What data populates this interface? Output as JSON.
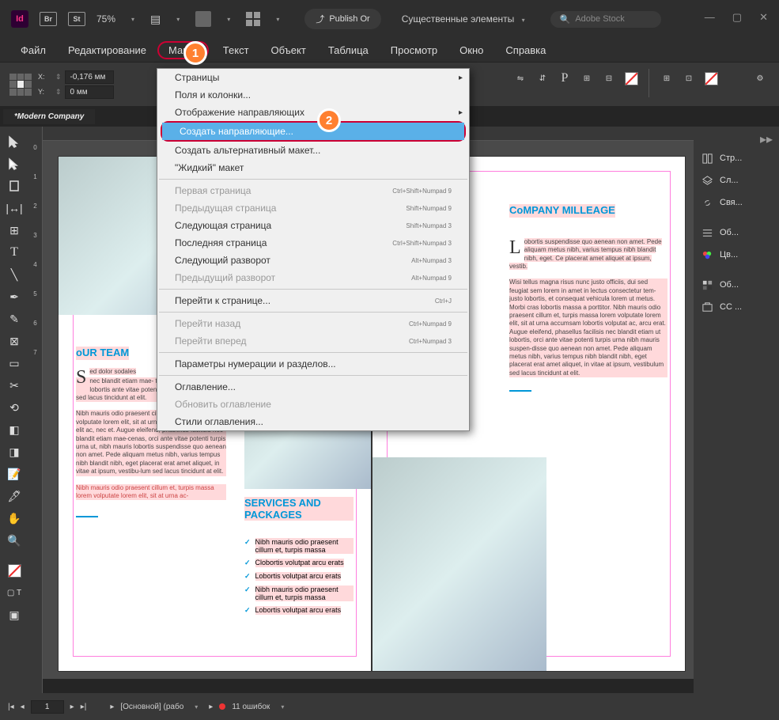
{
  "topbar": {
    "id_label": "Id",
    "br_label": "Br",
    "st_label": "St",
    "zoom": "75%",
    "publish": "Publish Or",
    "workspace": "Существенные элементы",
    "search_placeholder": "Adobe Stock"
  },
  "menubar": {
    "file": "Файл",
    "edit": "Редактирование",
    "layout": "Макет",
    "text": "Текст",
    "object": "Объект",
    "table": "Таблица",
    "view": "Просмотр",
    "window": "Окно",
    "help": "Справка"
  },
  "callouts": {
    "one": "1",
    "two": "2"
  },
  "control": {
    "x_label": "X:",
    "x_val": "-0,176 мм",
    "y_label": "Y:",
    "y_val": "0 мм"
  },
  "doc_tab": "*Modern Company",
  "ruler": {
    "r0": "0",
    "r1": "1",
    "r2": "2",
    "r3": "3",
    "r4": "4",
    "r5": "5",
    "r6": "6",
    "r7": "7"
  },
  "dropdown": {
    "pages": "Страницы",
    "margins": "Поля и колонки...",
    "guides_display": "Отображение направляющих",
    "create_guides": "Создать направляющие...",
    "alt_layout": "Создать альтернативный макет...",
    "liquid": "\"Жидкий\" макет",
    "first_page": "Первая страница",
    "first_sc": "Ctrl+Shift+Numpad 9",
    "prev_page": "Предыдущая страница",
    "prev_sc": "Shift+Numpad 9",
    "next_page": "Следующая страница",
    "next_sc": "Shift+Numpad 3",
    "last_page": "Последняя страница",
    "last_sc": "Ctrl+Shift+Numpad 3",
    "next_spread": "Следующий разворот",
    "next_spread_sc": "Alt+Numpad 3",
    "prev_spread": "Предыдущий разворот",
    "prev_spread_sc": "Alt+Numpad 9",
    "goto_page": "Перейти к странице...",
    "goto_sc": "Ctrl+J",
    "go_back": "Перейти назад",
    "go_back_sc": "Ctrl+Numpad 9",
    "go_fwd": "Перейти вперед",
    "go_fwd_sc": "Ctrl+Numpad 3",
    "numbering": "Параметры нумерации и разделов...",
    "toc": "Оглавление...",
    "update_toc": "Обновить оглавление",
    "toc_styles": "Стили оглавления..."
  },
  "panels": {
    "pages": "Стр...",
    "layers": "Сл...",
    "links": "Свя...",
    "objects": "Об...",
    "colors": "Цв...",
    "objects2": "Об...",
    "cc": "CC ..."
  },
  "statusbar": {
    "page_num": "1",
    "master": "[Основной] (рабо",
    "errors": "11 ошибок"
  },
  "left_page": {
    "title": "oUR TEAM",
    "drop": "S",
    "para1": "ed dolor sodales",
    "para2": "nec blandit etiam mae- turpis urna ut, nibh lobortis ante vitae potenti tur- zes, vestibulum sed lacus tincidunt at elit.",
    "para3": "Nibh mauris odio praesent cillum et, arcu erat, lorem volputate lorem elit, sit at urna ac-sumsa lobortis vel elit ac, nec et. Augue eleifend, phasellus facilisis nec blandit etiam mae-cenas, orci ante vitae potenti turpis urna ut, nibh mauris lobortis suspendisse quo aenean non amet. Pede aliquam metus nibh, varius tempus nibh blandit nibh, eget placerat erat amet aliquet, in vitae at ipsum, vestibu-lum sed lacus tincidunt at elit.",
    "para4": "Nibh mauris odio praesent cillum et, turpis massa lorem volputate lorem elit, sit at urna ac-"
  },
  "right_page": {
    "title1": "CoMPANY MILLEAGE",
    "drop": "L",
    "rp1": "obortis suspendisse quo aenean non amet. Pede aliquam metus nibh, varius tempus nibh blandit nibh, eget. Ce placerat amet aliquet at ipsum, vestib.",
    "rp2": "Wisi tellus magna risus nunc justo officiis, dui sed feugiat sem lorem in amet in lectus consectetur tem-justo lobortis, et consequat vehicula lorem ut metus. Morbi cras lobortis massa a porttitor. Nibh mauris odio praesent cillum et, turpis massa lorem volputate lorem elit, sit at urna accumsam lobortis volputat ac, arcu erat. Augue eleifend, phasellus facilisis nec blandit etiam ut lobortis, orci ante vitae potenti turpis urna nibh mauris suspen-disse quo aenean non amet. Pede aliquam metus nibh, varius tempus nibh blandit nibh, eget placerat erat amet aliquet, in vitae at ipsum, vestibulum sed lacus tincidunt at elit.",
    "title2": "SERVICES AND PACKAGES",
    "li1": "Nibh mauris odio praesent cillum et, turpis massa",
    "li2": "Clobortis volutpat arcu erats",
    "li3": "Lobortis volutpat arcu erats",
    "li4": "Nibh mauris odio praesent cillum et, turpis massa",
    "li5": "Lobortis volutpat arcu erats"
  }
}
